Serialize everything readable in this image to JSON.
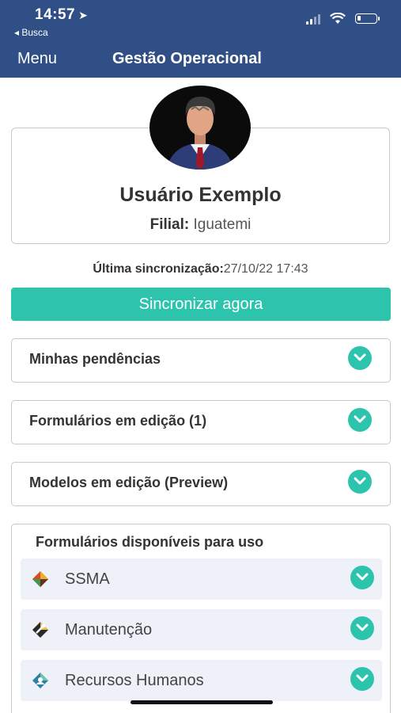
{
  "status_bar": {
    "time": "14:57",
    "back_label": "◂ Busca",
    "location_icon": "location-arrow-icon",
    "signal_icon": "signal-icon",
    "wifi_icon": "wifi-icon",
    "battery_icon": "battery-icon"
  },
  "navbar": {
    "menu_label": "Menu",
    "title": "Gestão Operacional"
  },
  "profile": {
    "avatar_icon": "user-avatar",
    "name": "Usuário Exemplo",
    "branch_label": "Filial:",
    "branch_value": "Iguatemi"
  },
  "sync": {
    "last_label": "Última sincronização:",
    "last_value": "27/10/22 17:43",
    "button_label": "Sincronizar agora"
  },
  "sections": [
    {
      "label": "Minhas pendências",
      "icon": "chevron-down-icon"
    },
    {
      "label": "Formulários em edição (1)",
      "icon": "chevron-down-icon"
    },
    {
      "label": "Modelos em edição (Preview)",
      "icon": "chevron-down-icon"
    }
  ],
  "available_forms": {
    "title": "Formulários disponíveis para uso",
    "items": [
      {
        "label": "SSMA",
        "icon": "ssma-icon"
      },
      {
        "label": "Manutenção",
        "icon": "maintenance-icon"
      },
      {
        "label": "Recursos Humanos",
        "icon": "hr-icon"
      }
    ]
  },
  "colors": {
    "header": "#2f4f86",
    "accent": "#2cc4ad",
    "card_border": "#c9c9c9",
    "item_background": "#eef1f7"
  }
}
